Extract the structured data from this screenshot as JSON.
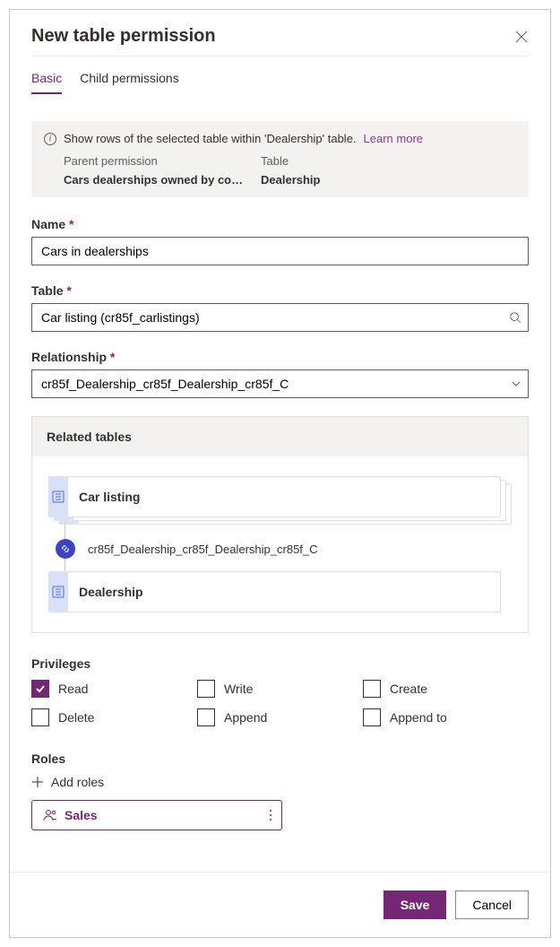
{
  "header": {
    "title": "New table permission"
  },
  "tabs": {
    "basic": "Basic",
    "child": "Child permissions",
    "active": "basic"
  },
  "info": {
    "text": "Show rows of the selected table within 'Dealership' table.",
    "learn_more": "Learn more",
    "parent_permission_label": "Parent permission",
    "parent_permission_value": "Cars dealerships owned by compa…",
    "table_label": "Table",
    "table_value": "Dealership"
  },
  "fields": {
    "name_label": "Name",
    "name_value": "Cars in dealerships",
    "table_label": "Table",
    "table_value": "Car listing (cr85f_carlistings)",
    "relationship_label": "Relationship",
    "relationship_value": "cr85f_Dealership_cr85f_Dealership_cr85f_C"
  },
  "related": {
    "header": "Related tables",
    "top_card": "Car listing",
    "link": "cr85f_Dealership_cr85f_Dealership_cr85f_C",
    "bottom_card": "Dealership"
  },
  "privileges": {
    "label": "Privileges",
    "read": "Read",
    "write": "Write",
    "create": "Create",
    "delete": "Delete",
    "append": "Append",
    "append_to": "Append to"
  },
  "roles": {
    "label": "Roles",
    "add": "Add roles",
    "items": [
      "Sales"
    ]
  },
  "footer": {
    "save": "Save",
    "cancel": "Cancel"
  }
}
